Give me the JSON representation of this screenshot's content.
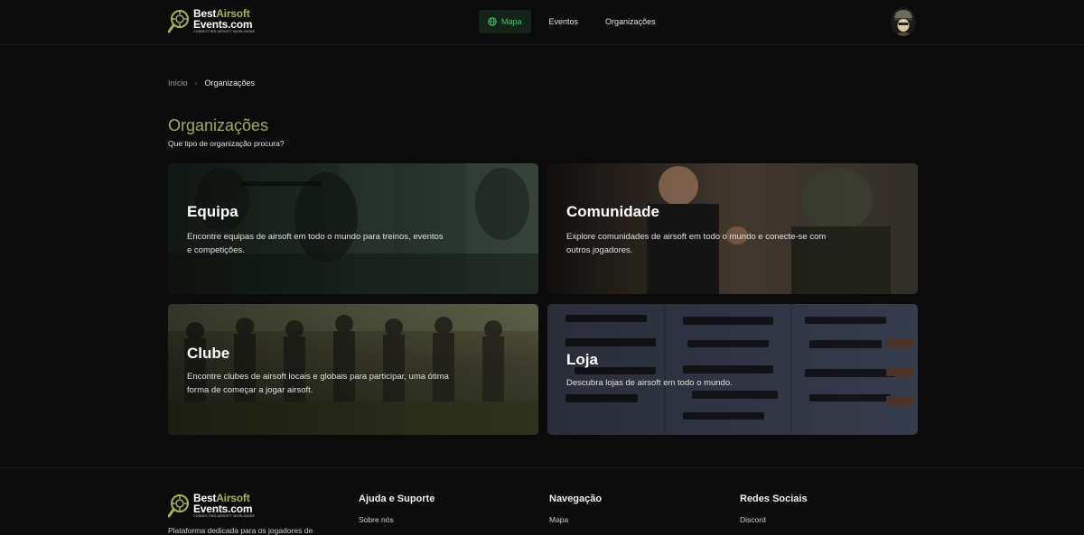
{
  "header": {
    "logo": {
      "line1_a": "Best",
      "line1_b": "Airsoft",
      "line2": "Events.com",
      "tagline": "CONNECTING AIRSOFT WORLDWIDE"
    },
    "nav": [
      {
        "label": "Mapa",
        "active": true
      },
      {
        "label": "Eventos",
        "active": false
      },
      {
        "label": "Organizações",
        "active": false
      }
    ]
  },
  "breadcrumb": {
    "home": "Início",
    "separator": "›",
    "current": "Organizações"
  },
  "page": {
    "title": "Organizações",
    "subtitle": "Que tipo de organização procura?"
  },
  "cards": {
    "equipa": {
      "title": "Equipa",
      "desc": "Encontre equipas de airsoft em todo o mundo para treinos, eventos e competições."
    },
    "comunidade": {
      "title": "Comunidade",
      "desc": "Explore comunidades de airsoft em todo o mundo e conecte-se com outros jogadores."
    },
    "clube": {
      "title": "Clube",
      "desc": "Encontre clubes de airsoft locais e globais para participar, uma ótima forma de começar a jogar airsoft."
    },
    "loja": {
      "title": "Loja",
      "desc": "Descubra lojas de airsoft em todo o mundo."
    }
  },
  "footer": {
    "desc": "Plataforma dedicada para os jogadores de",
    "col1": {
      "heading": "Ajuda e Suporte",
      "link": "Sobre nós"
    },
    "col2": {
      "heading": "Navegação",
      "link": "Mapa"
    },
    "col3": {
      "heading": "Redes Sociais",
      "link": "Discord"
    }
  },
  "colors": {
    "accent_green": "#3ec46d",
    "title_olive": "#9bad5e",
    "background": "#0b0b0b"
  }
}
